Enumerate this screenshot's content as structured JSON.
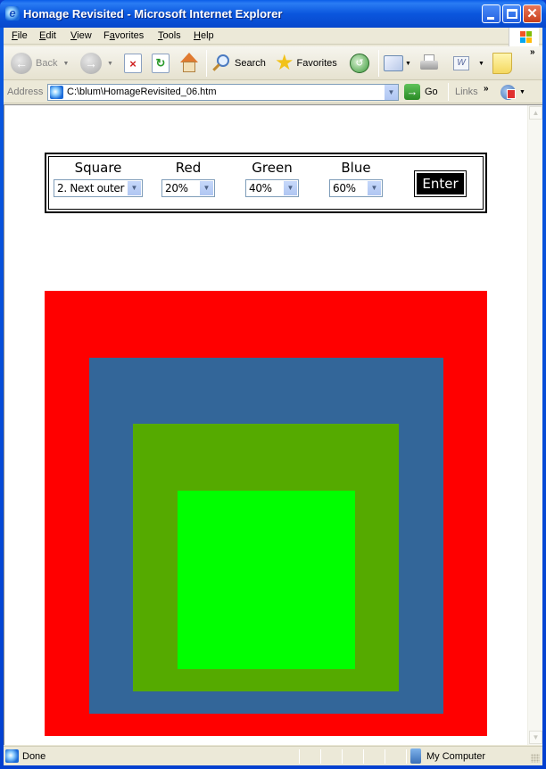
{
  "window": {
    "title": "Homage Revisited - Microsoft Internet Explorer",
    "buttons": {
      "minimize": "minimize",
      "maximize": "maximize",
      "close": "✕"
    }
  },
  "menu": {
    "items": [
      {
        "label": "File",
        "accel": "F"
      },
      {
        "label": "Edit",
        "accel": "E"
      },
      {
        "label": "View",
        "accel": "V"
      },
      {
        "label": "Favorites",
        "accel": "a"
      },
      {
        "label": "Tools",
        "accel": "T"
      },
      {
        "label": "Help",
        "accel": "H"
      }
    ]
  },
  "toolbar": {
    "back_label": "Back",
    "search_label": "Search",
    "favorites_label": "Favorites",
    "overflow": "»"
  },
  "address": {
    "label": "Address",
    "url": "C:\\blum\\HomageRevisited_06.htm",
    "go_label": "Go",
    "links_label": "Links",
    "links_overflow": "»"
  },
  "page": {
    "controls": {
      "square": {
        "label": "Square",
        "value": "2. Next outer"
      },
      "red": {
        "label": "Red",
        "value": "20%"
      },
      "green": {
        "label": "Green",
        "value": "40%"
      },
      "blue": {
        "label": "Blue",
        "value": "60%"
      },
      "enter_label": "Enter"
    },
    "squares": [
      {
        "name": "outer-square",
        "color": "#ff0000"
      },
      {
        "name": "next-outer-square",
        "color": "#336699"
      },
      {
        "name": "next-inner-square",
        "color": "#55aa00"
      },
      {
        "name": "inner-square",
        "color": "#00ff00"
      }
    ]
  },
  "status": {
    "text": "Done",
    "zone": "My Computer"
  }
}
